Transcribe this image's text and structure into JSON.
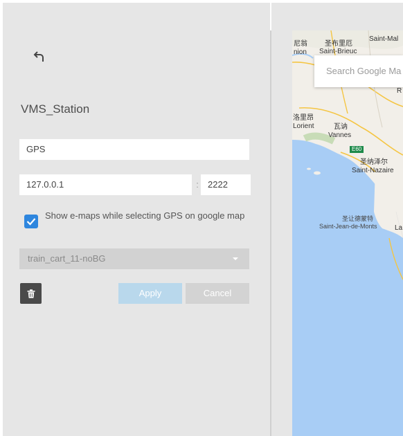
{
  "back_icon": "back-arrow-icon",
  "station_title": "VMS_Station",
  "name_field": {
    "value": "GPS"
  },
  "ip_field": {
    "value": "127.0.0.1"
  },
  "port_separator": ":",
  "port_field": {
    "value": "2222"
  },
  "emap_checkbox": {
    "checked": true,
    "label": "Show e-maps while selecting GPS on google map"
  },
  "emap_select": {
    "selected": "train_cart_11-noBG"
  },
  "trash_icon": "trash-icon",
  "buttons": {
    "apply": "Apply",
    "cancel": "Cancel"
  },
  "map": {
    "search_placeholder": "Search Google Ma",
    "labels": {
      "city1_cjk": "圣布里厄",
      "city1": "Saint-Brieuc",
      "city2": "Saint-Mal",
      "city3_cjk": "洛里昂",
      "city3": "Lorient",
      "city4_cjk": "瓦讷",
      "city4": "Vannes",
      "road": "E60",
      "city5_cjk": "圣纳泽尔",
      "city5": "Saint-Nazaire",
      "city6_cjk": "圣让德蒙特",
      "city6": "Saint-Jean-de-Monts",
      "frag1": "尼翁",
      "frag2": "nion",
      "frag3": "R",
      "frag4": "La"
    },
    "colors": {
      "sea": "#a8cdf5",
      "land": "#f2efe9",
      "road": "#f5c542"
    }
  }
}
